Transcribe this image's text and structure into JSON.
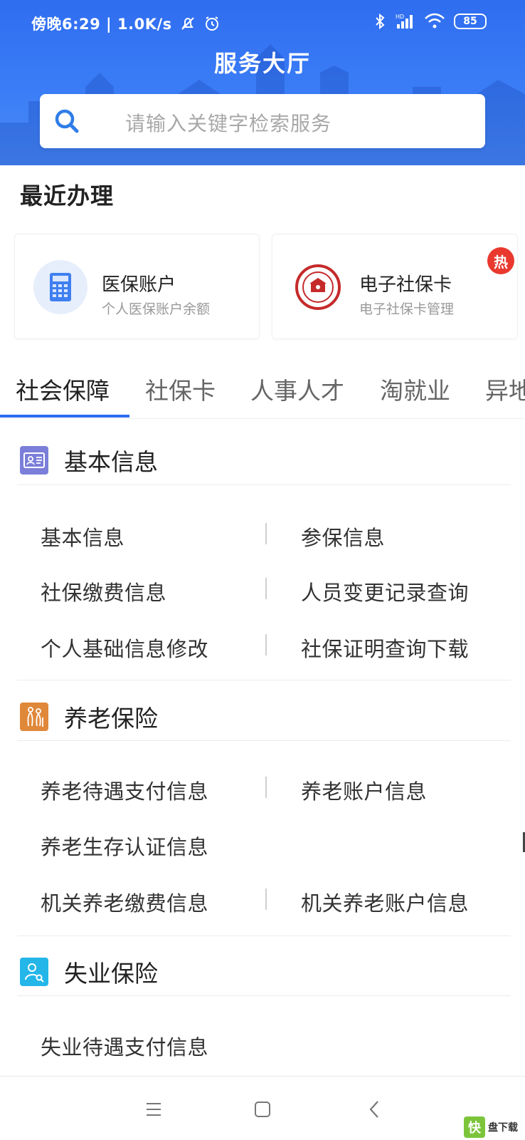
{
  "status_bar": {
    "time_text": "傍晚6:29 | 1.0K/s",
    "battery": "85",
    "hd_label": "HD"
  },
  "header": {
    "title": "服务大厅",
    "search_placeholder": "请输入关键字检索服务",
    "accent_color": "#2f6df0"
  },
  "recent": {
    "title": "最近办理",
    "cards": [
      {
        "title": "医保账户",
        "subtitle": "个人医保账户余额",
        "icon": "calculator-icon"
      },
      {
        "title": "电子社保卡",
        "subtitle": "电子社保卡管理",
        "icon": "social-security-card-icon",
        "badge": "热"
      }
    ]
  },
  "tabs": [
    "社会保障",
    "社保卡",
    "人事人才",
    "淘就业",
    "异地"
  ],
  "sections": [
    {
      "title": "基本信息",
      "icon": "id-card-icon",
      "items": [
        "基本信息",
        "参保信息",
        "社保缴费信息",
        "人员变更记录查询",
        "个人基础信息修改",
        "社保证明查询下载"
      ]
    },
    {
      "title": "养老保险",
      "icon": "elderly-icon",
      "items": [
        "养老待遇支付信息",
        "养老账户信息",
        "养老生存认证信息",
        "机关养老缴费信息",
        "机关养老账户信息"
      ]
    },
    {
      "title": "失业保险",
      "icon": "user-search-icon",
      "items": [
        "失业待遇支付信息"
      ]
    }
  ],
  "nav": {
    "menu": "menu-icon",
    "home": "home-icon",
    "back": "back-icon"
  },
  "watermark": {
    "logo": "快",
    "text": "盘下载"
  }
}
